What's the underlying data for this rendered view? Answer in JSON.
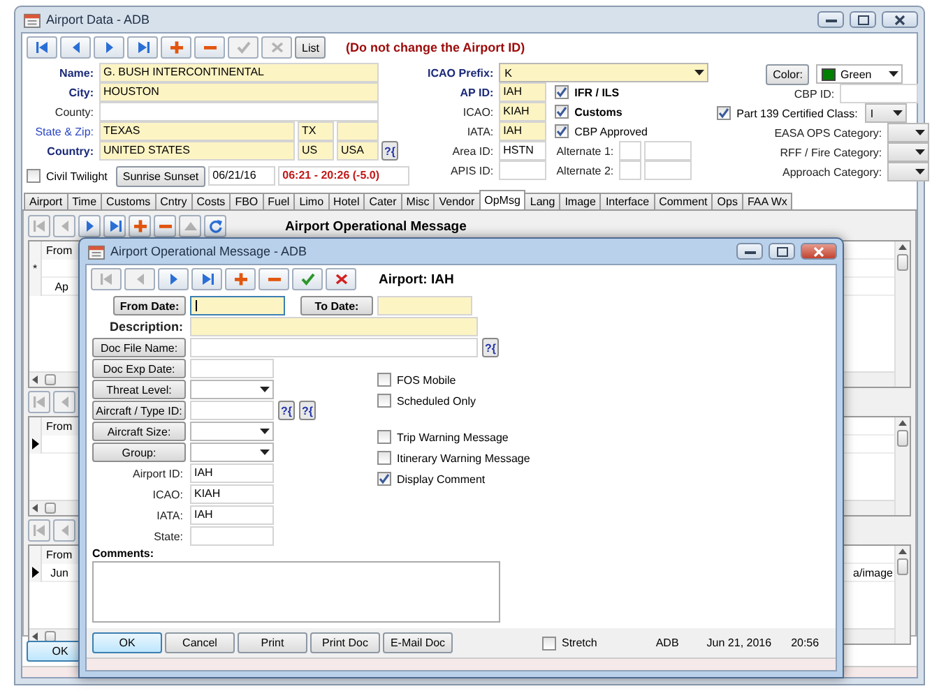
{
  "main_window": {
    "title": "Airport Data - ADB",
    "active": false,
    "toolbar": [
      {
        "kind": "first",
        "disabled": false
      },
      {
        "kind": "prev",
        "disabled": false
      },
      {
        "kind": "next",
        "disabled": false
      },
      {
        "kind": "last",
        "disabled": false
      },
      {
        "kind": "add",
        "disabled": false
      },
      {
        "kind": "delete",
        "disabled": false
      },
      {
        "kind": "save",
        "disabled": true
      },
      {
        "kind": "cancel",
        "disabled": true
      }
    ],
    "list_button": "List",
    "warning": "(Do not change the Airport ID)",
    "left_fields": [
      {
        "label": "Name:",
        "kind": "required",
        "highlighted": true,
        "values": [
          "G. BUSH INTERCONTINENTAL"
        ]
      },
      {
        "label": "City:",
        "kind": "required",
        "highlighted": true,
        "values": [
          "HOUSTON"
        ]
      },
      {
        "label": "County:",
        "kind": "plain",
        "highlighted": false
      },
      {
        "label": "State & Zip:",
        "kind": "link",
        "highlighted": true,
        "values": [
          "TEXAS",
          "TX"
        ]
      },
      {
        "label": "Country:",
        "kind": "required",
        "highlighted": true,
        "values": [
          "UNITED STATES",
          "US",
          "USA"
        ],
        "lookup": "?{"
      }
    ],
    "civil_twilight": {
      "label": "Civil Twilight",
      "checked": false
    },
    "sunrise_button": "Sunrise Sunset",
    "date": "06/21/16",
    "daylight": "06:21 - 20:26 (-5.0)",
    "icao_prefix": {
      "label": "ICAO Prefix:",
      "value": "K"
    },
    "id_fields": [
      {
        "label": "AP ID:",
        "kind": "required",
        "highlighted": true,
        "value": "IAH"
      },
      {
        "label": "ICAO:",
        "kind": "plain",
        "highlighted": true,
        "value": "KIAH"
      },
      {
        "label": "IATA:",
        "kind": "plain",
        "highlighted": true,
        "value": "IAH"
      },
      {
        "label": "Area ID:",
        "kind": "plain",
        "highlighted": false,
        "value": "HSTN"
      },
      {
        "label": "APIS ID:",
        "kind": "plain",
        "highlighted": false
      }
    ],
    "flags": [
      {
        "label": "IFR / ILS",
        "checked": true,
        "bold": true
      },
      {
        "label": "Customs",
        "checked": true,
        "bold": true
      },
      {
        "label": "CBP Approved",
        "checked": true,
        "bold": false
      }
    ],
    "alternates": [
      {
        "label": "Alternate 1:"
      },
      {
        "label": "Alternate 2:"
      }
    ],
    "color_picker": {
      "button": "Color:",
      "value": "Green",
      "color": "#008000"
    },
    "cbp_id": {
      "label": "CBP ID:"
    },
    "part139": {
      "label": "Part 139 Certified Class:",
      "checked": true,
      "value": "I"
    },
    "categories": [
      {
        "label": "EASA OPS Category:"
      },
      {
        "label": "RFF / Fire Category:"
      },
      {
        "label": "Approach Category:"
      }
    ],
    "tabs": [
      {
        "label": "Airport",
        "selected": false
      },
      {
        "label": "Time",
        "selected": false
      },
      {
        "label": "Customs",
        "selected": false
      },
      {
        "label": "Cntry",
        "selected": false
      },
      {
        "label": "Costs",
        "selected": false
      },
      {
        "label": "FBO",
        "selected": false
      },
      {
        "label": "Fuel",
        "selected": false
      },
      {
        "label": "Limo",
        "selected": false
      },
      {
        "label": "Hotel",
        "selected": false
      },
      {
        "label": "Cater",
        "selected": false
      },
      {
        "label": "Misc",
        "selected": false
      },
      {
        "label": "Vendor",
        "selected": false
      },
      {
        "label": "OpMsg",
        "selected": true
      },
      {
        "label": "Lang",
        "selected": false
      },
      {
        "label": "Image",
        "selected": false
      },
      {
        "label": "Interface",
        "selected": false
      },
      {
        "label": "Comment",
        "selected": false
      },
      {
        "label": "Ops",
        "selected": false
      },
      {
        "label": "FAA Wx",
        "selected": false
      }
    ],
    "sections": [
      {
        "toolbar": [
          {
            "kind": "first",
            "disabled": true
          },
          {
            "kind": "prev",
            "disabled": true
          },
          {
            "kind": "next",
            "disabled": false
          },
          {
            "kind": "last",
            "disabled": false
          },
          {
            "kind": "add",
            "disabled": false
          },
          {
            "kind": "delete",
            "disabled": false
          },
          {
            "kind": "up",
            "disabled": true
          },
          {
            "kind": "refresh",
            "disabled": false
          }
        ],
        "heading": "Airport Operational Message",
        "grid": {
          "header": "From",
          "rows": [
            {
              "current": false,
              "marker": "*"
            },
            {
              "current": false,
              "cells": [
                "Ap"
              ]
            }
          ]
        }
      },
      {
        "toolbar": [
          {
            "kind": "first",
            "disabled": true
          },
          {
            "kind": "prev",
            "disabled": true
          }
        ],
        "grid": {
          "header": "From",
          "rows": [
            {
              "current": true
            }
          ]
        }
      },
      {
        "toolbar": [
          {
            "kind": "first",
            "disabled": true
          },
          {
            "kind": "prev",
            "disabled": true
          }
        ],
        "grid": {
          "header": "From",
          "rows": [
            {
              "current": true,
              "cells": [
                "Jun",
                "a/image"
              ]
            }
          ]
        }
      }
    ],
    "ok_button": "OK"
  },
  "dialog": {
    "title": "Airport Operational Message - ADB",
    "active": true,
    "toolbar": [
      {
        "kind": "first",
        "disabled": true
      },
      {
        "kind": "prev",
        "disabled": true
      },
      {
        "kind": "next",
        "disabled": false
      },
      {
        "kind": "last",
        "disabled": false
      },
      {
        "kind": "add",
        "disabled": false
      },
      {
        "kind": "delete",
        "disabled": false
      },
      {
        "kind": "save",
        "disabled": false
      },
      {
        "kind": "cancel",
        "disabled": false
      }
    ],
    "airport": "Airport: IAH",
    "date_fields": [
      {
        "label": "From Date:",
        "focused": true
      },
      {
        "label": "To Date:",
        "focused": false
      }
    ],
    "description": {
      "label": "Description:"
    },
    "doc_file": {
      "label": "Doc File Name:",
      "lookup": "?{"
    },
    "left_rows": [
      {
        "kind": "button_field",
        "label": "Doc Exp Date:"
      },
      {
        "kind": "button_combo",
        "label": "Threat Level:"
      },
      {
        "kind": "button_field",
        "label": "Aircraft / Type ID:",
        "lookups": [
          "?{",
          "?{"
        ]
      },
      {
        "kind": "button_combo",
        "label": "Aircraft Size:"
      },
      {
        "kind": "button_combo",
        "label": "Group:"
      },
      {
        "kind": "label_field",
        "label": "Airport ID:",
        "value": "IAH"
      },
      {
        "kind": "label_field",
        "label": "ICAO:",
        "value": "KIAH"
      },
      {
        "kind": "label_field",
        "label": "IATA:",
        "value": "IAH"
      },
      {
        "kind": "label_field",
        "label": "State:"
      }
    ],
    "option_groups": [
      [
        {
          "label": "FOS Mobile",
          "checked": false
        },
        {
          "label": "Scheduled Only",
          "checked": false
        }
      ],
      [
        {
          "label": "Trip Warning Message",
          "checked": false
        },
        {
          "label": "Itinerary Warning Message",
          "checked": false
        },
        {
          "label": "Display Comment",
          "checked": true
        }
      ]
    ],
    "comments_label": "Comments:",
    "buttons": [
      {
        "label": "OK",
        "focused": true
      },
      {
        "label": "Cancel",
        "focused": false
      },
      {
        "label": "Print",
        "focused": false
      },
      {
        "label": "Print Doc",
        "focused": false
      },
      {
        "label": "E-Mail Doc",
        "focused": false
      }
    ],
    "stretch": {
      "label": "Stretch",
      "checked": false
    },
    "footer": [
      "ADB",
      "Jun 21, 2016",
      "20:56"
    ]
  }
}
